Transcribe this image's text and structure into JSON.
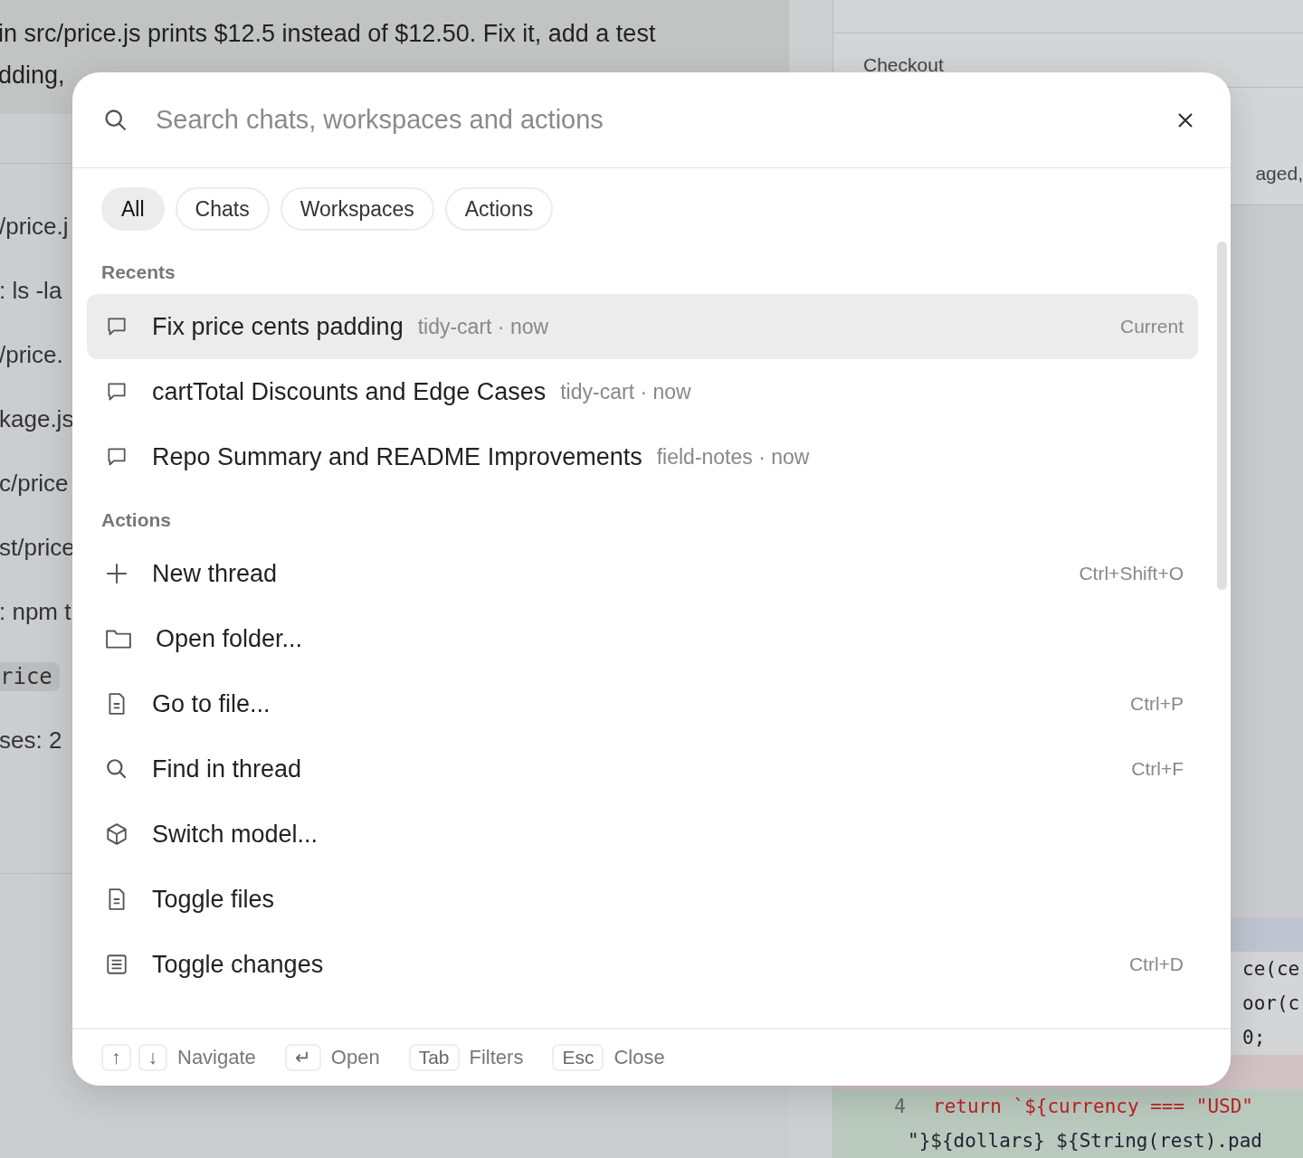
{
  "background": {
    "message_lines": [
      "in src/price.js prints $12.5 instead of $12.50. Fix it, add a test",
      "dding,"
    ],
    "steps": [
      {
        "text": "/price.j",
        "kind": "text"
      },
      {
        "text": ": ls -la",
        "kind": "text"
      },
      {
        "text": "/price.",
        "kind": "text"
      },
      {
        "text": "kage.js",
        "kind": "text"
      },
      {
        "text": "c/price",
        "kind": "text"
      },
      {
        "text": "st/price",
        "kind": "text"
      },
      {
        "text": ": npm t",
        "kind": "text"
      },
      {
        "text": "rice",
        "kind": "code"
      },
      {
        "text": "ses: 2",
        "kind": "text"
      }
    ],
    "side_rows": [
      "Checkout",
      "aged,"
    ],
    "code_lines": [
      {
        "kind": "plain",
        "text": "ce(ce"
      },
      {
        "kind": "plain",
        "text": "oor(c"
      },
      {
        "kind": "plain",
        "text": "0;"
      },
      {
        "kind": "deleted"
      },
      {
        "kind": "added",
        "number": "4",
        "text": "return `${currency === \"USD\""
      },
      {
        "kind": "added",
        "text": "\"}${dollars} ${String(rest).pad"
      }
    ]
  },
  "palette": {
    "search": {
      "placeholder": "Search chats, workspaces and actions"
    },
    "filters": [
      {
        "label": "All",
        "selected": true
      },
      {
        "label": "Chats",
        "selected": false
      },
      {
        "label": "Workspaces",
        "selected": false
      },
      {
        "label": "Actions",
        "selected": false
      }
    ],
    "recents_heading": "Recents",
    "recents": [
      {
        "title": "Fix price cents padding",
        "meta": "tidy-cart · now",
        "badge": "Current",
        "selected": true
      },
      {
        "title": "cartTotal Discounts and Edge Cases",
        "meta": "tidy-cart · now",
        "selected": false
      },
      {
        "title": "Repo Summary and README Improvements",
        "meta": "field-notes · now",
        "selected": false
      }
    ],
    "actions_heading": "Actions",
    "actions": [
      {
        "kind": "plus",
        "label": "New thread",
        "shortcut": "Ctrl+Shift+O"
      },
      {
        "kind": "folder",
        "label": "Open folder..."
      },
      {
        "kind": "file",
        "label": "Go to file...",
        "shortcut": "Ctrl+P"
      },
      {
        "kind": "search",
        "label": "Find in thread",
        "shortcut": "Ctrl+F"
      },
      {
        "kind": "cube",
        "label": "Switch model..."
      },
      {
        "kind": "file",
        "label": "Toggle files"
      },
      {
        "kind": "list",
        "label": "Toggle changes",
        "shortcut": "Ctrl+D"
      }
    ],
    "footer": [
      {
        "keys": [
          "↑",
          "↓"
        ],
        "label": "Navigate"
      },
      {
        "keys": [
          "↵"
        ],
        "label": "Open"
      },
      {
        "keys": [
          "Tab"
        ],
        "label": "Filters"
      },
      {
        "keys": [
          "Esc"
        ],
        "label": "Close"
      }
    ]
  }
}
